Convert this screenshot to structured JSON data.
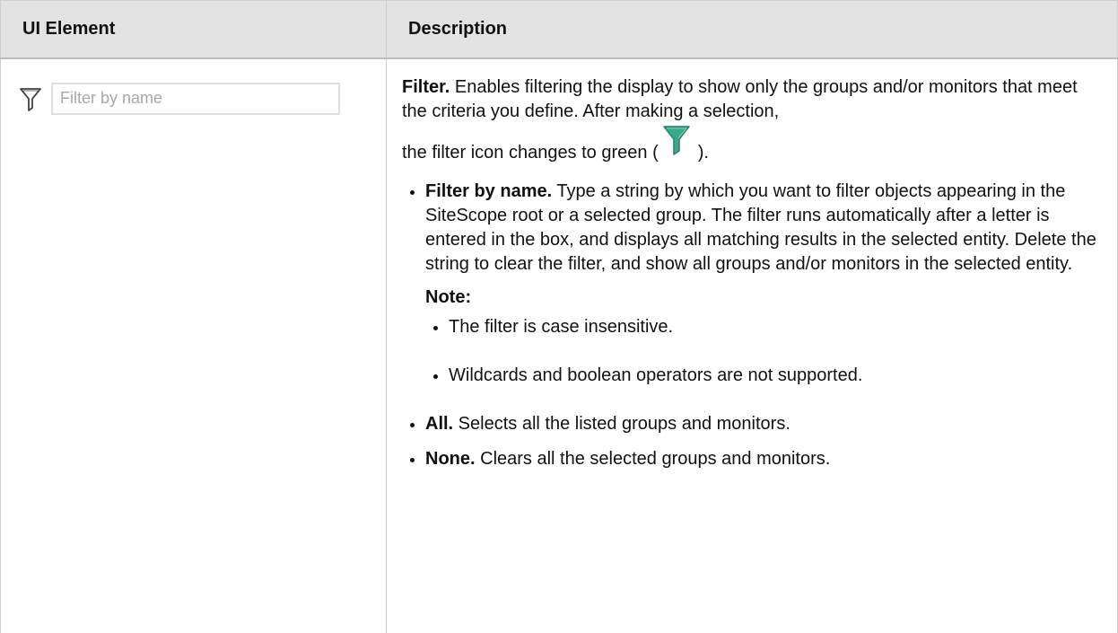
{
  "table": {
    "headers": {
      "ui_element": "UI Element",
      "description": "Description"
    },
    "row": {
      "filter_input": {
        "placeholder": "Filter by name",
        "value": ""
      },
      "filter_icon": "funnel-outline-icon",
      "intro": {
        "label": "Filter.",
        "text": " Enables filtering the display to show only the groups and/or monitors that meet the criteria you define. After making a selection,"
      },
      "green_line": {
        "before": "the filter icon changes to green (",
        "after": ").",
        "icon": "green-funnel-icon",
        "icon_color": "#3aaa8c"
      },
      "bullets": [
        {
          "label": "Filter by name.",
          "text": " Type a string by which you want to filter objects appearing in the SiteScope root or a selected group. The filter runs automatically after a letter is entered in the box, and displays all matching results in the selected entity. Delete the string to clear the filter, and show all groups and/or monitors in the selected entity."
        },
        {
          "label": "All.",
          "text": " Selects all the listed groups and monitors."
        },
        {
          "label": "None.",
          "text": " Clears all the selected groups and monitors."
        }
      ],
      "note": {
        "label": "Note:",
        "items": [
          "The filter is case insensitive.",
          "Wildcards and boolean operators are not supported."
        ]
      }
    }
  },
  "colors": {
    "header_bg": "#e3e3e3",
    "border": "#cfcfcf",
    "green_icon": "#3aaa8c"
  }
}
